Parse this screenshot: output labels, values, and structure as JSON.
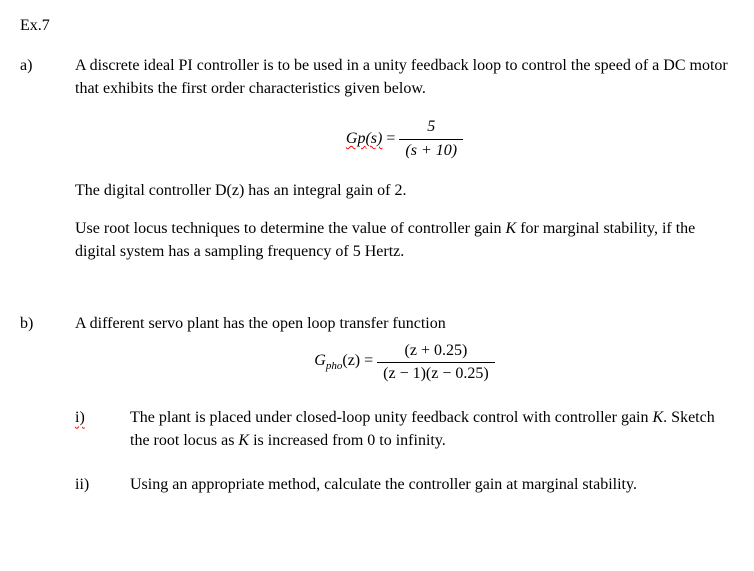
{
  "header": "Ex.7",
  "partA": {
    "label": "a)",
    "intro": "A discrete ideal PI controller is to be used in a unity feedback loop to control the speed of a DC motor that exhibits the first order characteristics given below.",
    "eq": {
      "lhs_gp": "Gp",
      "lhs_s": "(s)",
      "eq_sign": " = ",
      "num": "5",
      "den_open": "(s + 10)"
    },
    "line2_pre": "The digital controller D(z) has an integral gain of 2.",
    "line3_pre": "Use root locus techniques to determine the value of controller gain ",
    "line3_K": "K",
    "line3_post": " for marginal stability, if the digital system has a sampling frequency of 5 Hertz."
  },
  "partB": {
    "label": "b)",
    "intro": "A different servo plant has the open loop transfer function",
    "eq": {
      "G": "G",
      "sub": "pho",
      "arg": "(z) = ",
      "num": "(z + 0.25)",
      "den": "(z − 1)(z − 0.25)"
    },
    "i": {
      "label": "i)",
      "text_pre": "The plant is placed under closed-loop unity feedback control with controller gain ",
      "K1": "K",
      "text_mid": ".  Sketch the root locus as ",
      "K2": "K",
      "text_post": " is increased from 0 to infinity."
    },
    "ii": {
      "label": "ii)",
      "text": "Using an appropriate method, calculate the controller gain at marginal stability."
    }
  }
}
